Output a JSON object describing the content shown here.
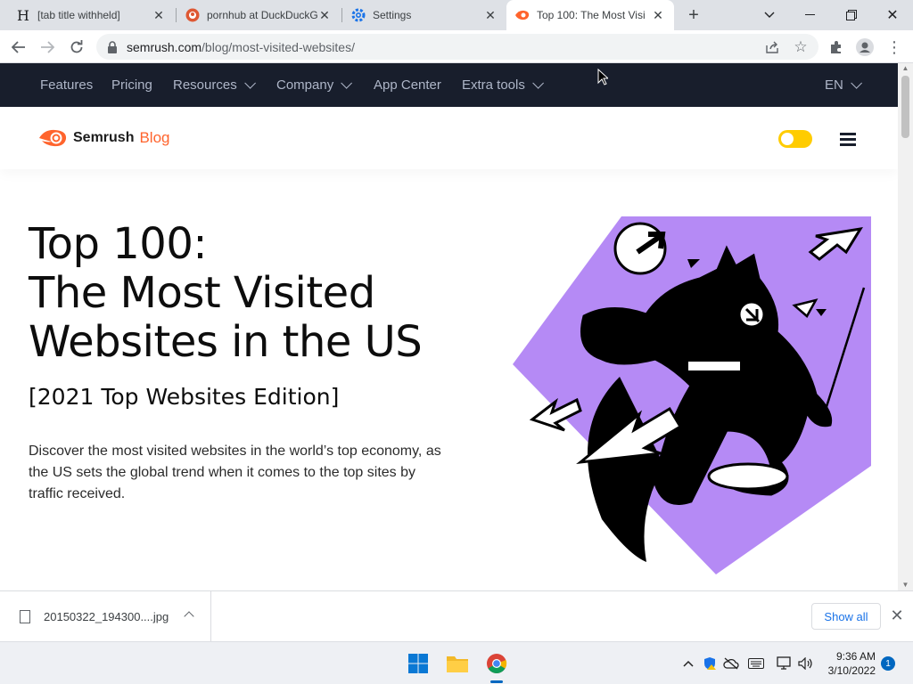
{
  "browser": {
    "tabs": [
      {
        "title": "[tab title withheld]",
        "favicon": "h-letter-icon",
        "active": false
      },
      {
        "title": "pornhub at DuckDuckG",
        "favicon": "duckduckgo-icon",
        "active": false
      },
      {
        "title": "Settings",
        "favicon": "gear-icon",
        "active": false
      },
      {
        "title": "Top 100: The Most Visi",
        "favicon": "semrush-icon",
        "active": true
      }
    ],
    "url_domain": "semrush.com",
    "url_path": "/blog/most-visited-websites/"
  },
  "site_nav": {
    "items": [
      {
        "label": "Features",
        "dropdown": false
      },
      {
        "label": "Pricing",
        "dropdown": false
      },
      {
        "label": "Resources",
        "dropdown": true
      },
      {
        "label": "Company",
        "dropdown": true
      },
      {
        "label": "App Center",
        "dropdown": false
      },
      {
        "label": "Extra tools",
        "dropdown": true
      }
    ],
    "language": "EN"
  },
  "blog_header": {
    "brand": "Semrush",
    "section": "Blog",
    "theme_toggle_on": true
  },
  "article": {
    "title_lines": [
      "Top 100:",
      "The Most Visited",
      "Websites in the US"
    ],
    "subtitle": "[2021 Top Websites Edition]",
    "description": "Discover the most visited websites in the world’s top economy, as the US sets the global trend when it comes to the top sites by traffic received."
  },
  "download_shelf": {
    "file_name": "20150322_194300....jpg",
    "show_all_label": "Show all"
  },
  "taskbar": {
    "time": "9:36 AM",
    "date": "3/10/2022",
    "notification_count": "1"
  },
  "colors": {
    "semrush_orange": "#ff642d",
    "nav_dark": "#181e2c",
    "hero_purple": "#b58af5",
    "toggle_yellow": "#ffcc00"
  }
}
